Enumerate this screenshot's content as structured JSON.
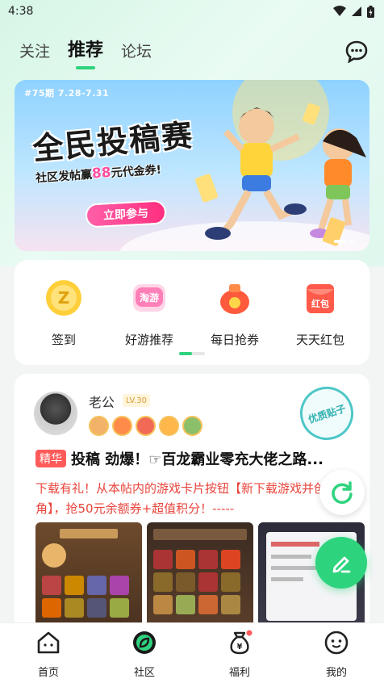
{
  "status_bar": {
    "time": "4:38"
  },
  "nav": {
    "tabs": [
      "关注",
      "推荐",
      "论坛"
    ],
    "active": "推荐"
  },
  "banner": {
    "period": "#75期  7.28-7.31",
    "title": "全民投稿赛",
    "subtitle_prefix": "社区发帖赢",
    "subtitle_amount": "88",
    "subtitle_suffix": "元代金券!",
    "cta": "立即参与"
  },
  "quick_entries": [
    {
      "label": "签到",
      "icon": "coin-icon"
    },
    {
      "label": "好游推荐",
      "icon": "taoyou-icon",
      "icon_text": "淘游"
    },
    {
      "label": "每日抢券",
      "icon": "coupon-bag-icon"
    },
    {
      "label": "天天红包",
      "icon": "red-envelope-icon",
      "icon_text": "红包"
    }
  ],
  "post": {
    "username": "老公",
    "level": "LV.30",
    "quality_stamp": "优质贴子",
    "tag": "精华",
    "title": "投稿 劲爆！☞百龙霸业零充大佬之路...",
    "body": "下载有礼！从本帖内的游戏卡片按钮【新下载游戏并创角】，抢50元余额券+超值积分！-----"
  },
  "bottom_nav": [
    {
      "label": "首页",
      "icon": "home-icon"
    },
    {
      "label": "社区",
      "icon": "community-icon"
    },
    {
      "label": "福利",
      "icon": "welfare-bag-icon"
    },
    {
      "label": "我的",
      "icon": "profile-icon"
    }
  ],
  "colors": {
    "accent": "#2ed37e",
    "red": "#e8453c",
    "pink": "#ff2f7f"
  }
}
